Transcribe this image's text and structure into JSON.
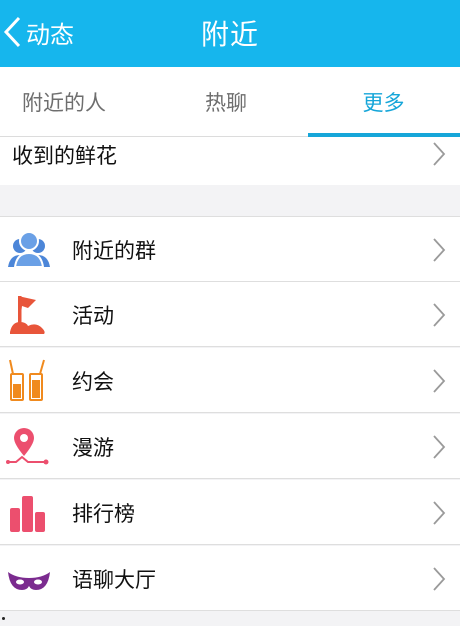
{
  "header": {
    "back_label": "动态",
    "title": "附近",
    "accent": "#16b6ed"
  },
  "tabs": [
    {
      "label": "附近的人",
      "active": false
    },
    {
      "label": "热聊",
      "active": false
    },
    {
      "label": "更多",
      "active": true
    }
  ],
  "flowers_item": {
    "label": "收到的鲜花"
  },
  "menu": [
    {
      "label": "附近的群",
      "icon": "group-icon"
    },
    {
      "label": "活动",
      "icon": "flag-icon"
    },
    {
      "label": "约会",
      "icon": "drinks-icon"
    },
    {
      "label": "漫游",
      "icon": "location-pin-icon"
    },
    {
      "label": "排行榜",
      "icon": "ranking-bars-icon"
    },
    {
      "label": "语聊大厅",
      "icon": "mask-icon"
    }
  ]
}
